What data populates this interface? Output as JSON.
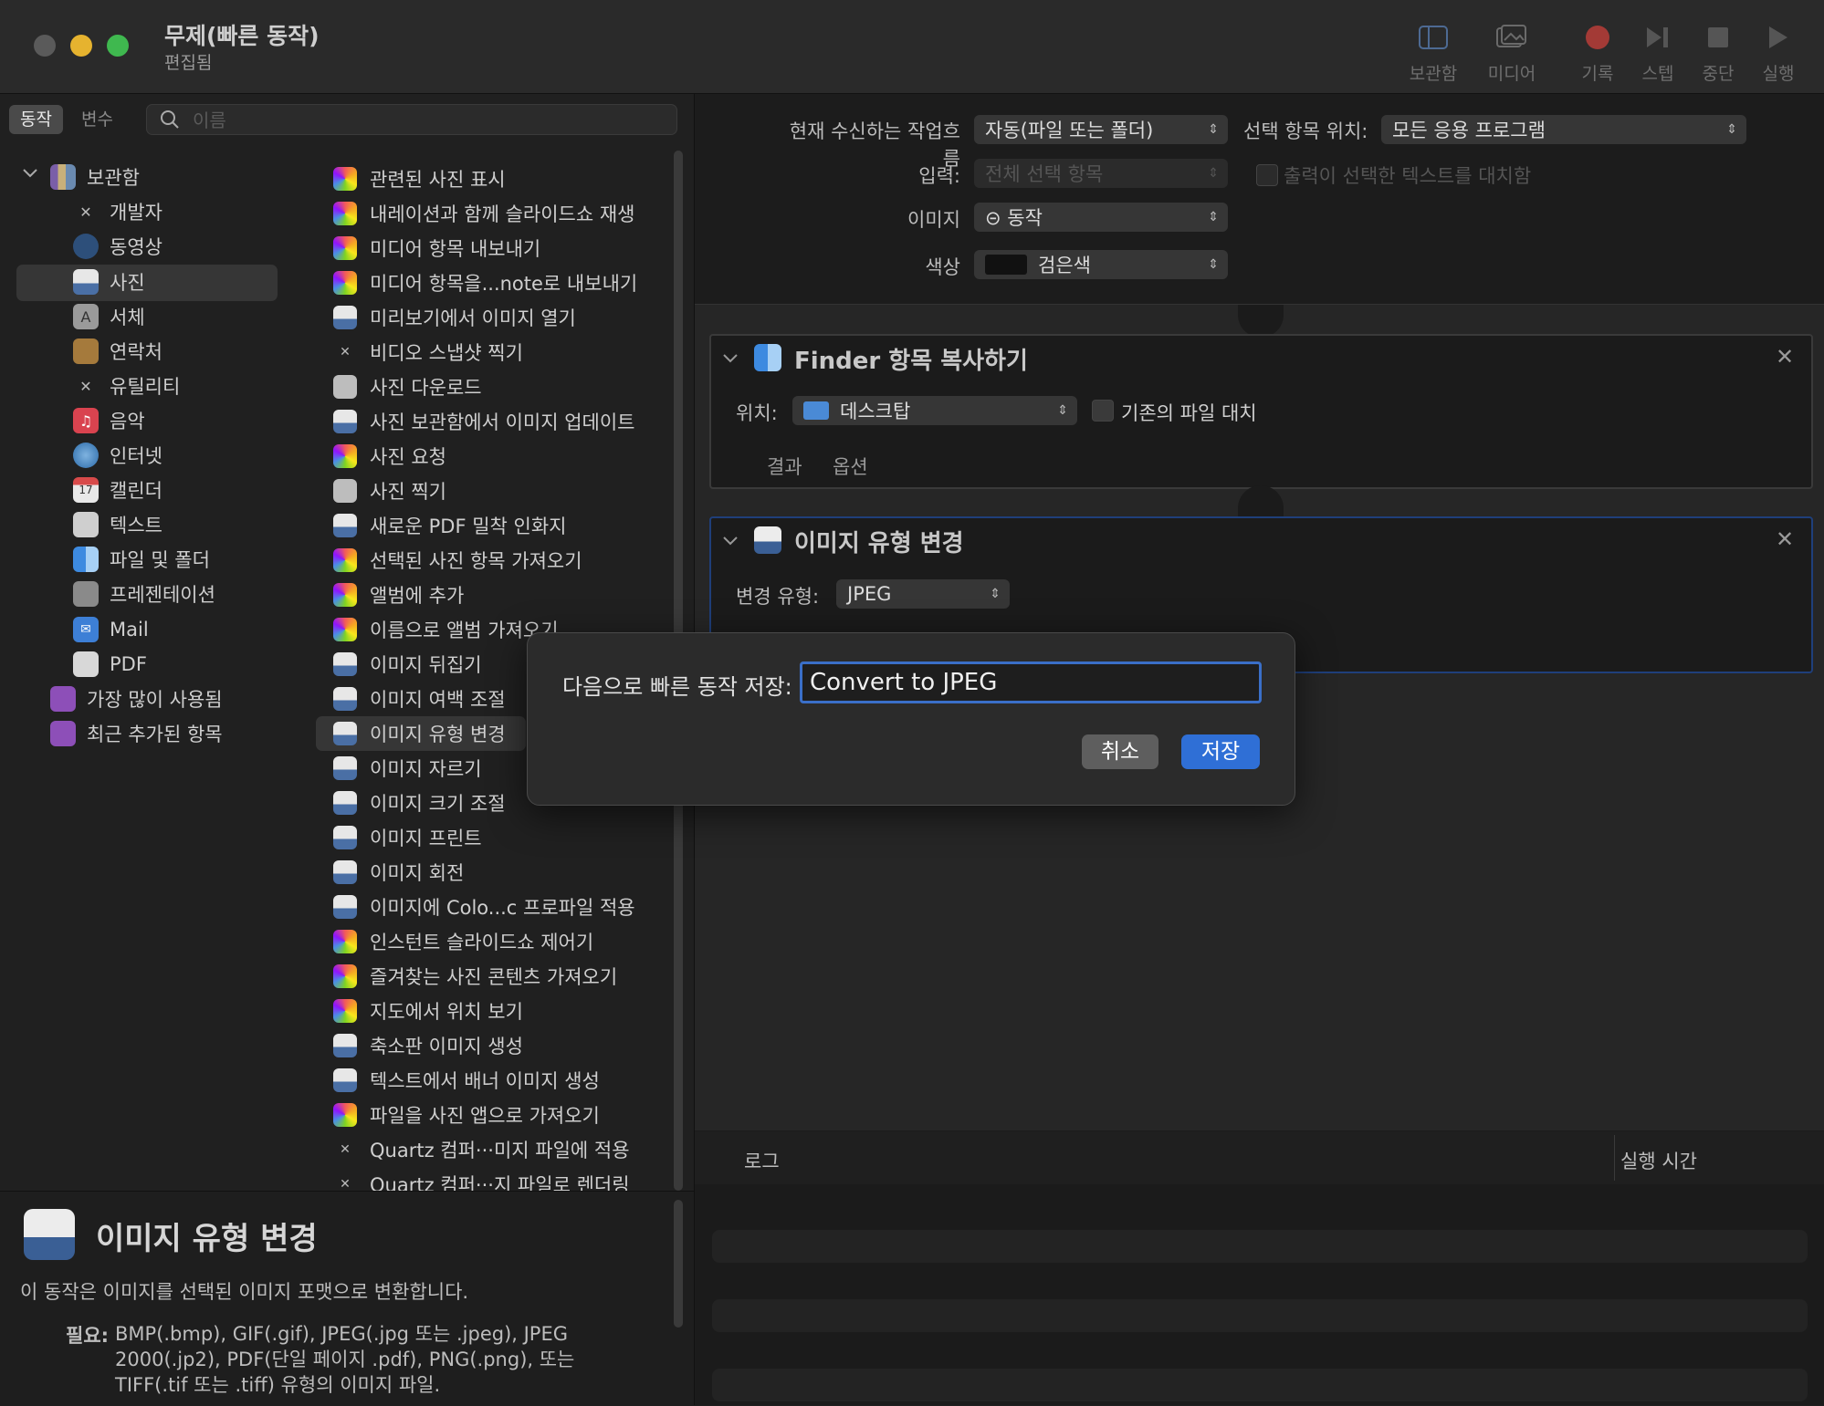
{
  "window": {
    "title": "무제(빠른 동작)",
    "subtitle": "편집됨"
  },
  "toolbar": {
    "buttons": [
      {
        "label": "보관함",
        "icon": "sidebar-icon"
      },
      {
        "label": "미디어",
        "icon": "media-icon"
      },
      {
        "label": "기록",
        "icon": "record-icon"
      },
      {
        "label": "스텝",
        "icon": "step-icon"
      },
      {
        "label": "중단",
        "icon": "stop-icon"
      },
      {
        "label": "실행",
        "icon": "play-icon"
      }
    ]
  },
  "left": {
    "segment": {
      "actions": "동작",
      "variables": "변수"
    },
    "search_placeholder": "이름",
    "library": [
      {
        "label": "보관함",
        "icon": "library-icon"
      },
      {
        "label": "개발자",
        "icon": "tools-icon"
      },
      {
        "label": "동영상",
        "icon": "movie-icon"
      },
      {
        "label": "사진",
        "icon": "photo-icon"
      },
      {
        "label": "서체",
        "icon": "font-icon"
      },
      {
        "label": "연락처",
        "icon": "contacts-icon"
      },
      {
        "label": "유틸리티",
        "icon": "utility-icon"
      },
      {
        "label": "음악",
        "icon": "music-icon"
      },
      {
        "label": "인터넷",
        "icon": "globe-icon"
      },
      {
        "label": "캘린더",
        "icon": "calendar-icon"
      },
      {
        "label": "텍스트",
        "icon": "text-icon"
      },
      {
        "label": "파일 및 폴더",
        "icon": "finder-icon"
      },
      {
        "label": "프레젠테이션",
        "icon": "presentation-icon"
      },
      {
        "label": "Mail",
        "icon": "mail-icon"
      },
      {
        "label": "PDF",
        "icon": "pdf-icon"
      },
      {
        "label": "가장 많이 사용됨",
        "icon": "smart-folder-icon"
      },
      {
        "label": "최근 추가된 항목",
        "icon": "smart-folder-icon"
      }
    ],
    "actions": [
      "관련된 사진 표시",
      "내레이션과 함께 슬라이드쇼 재생",
      "미디어 항목 내보내기",
      "미디어 항목을...note로 내보내기",
      "미리보기에서 이미지 열기",
      "비디오 스냅샷 찍기",
      "사진 다운로드",
      "사진 보관함에서 이미지 업데이트",
      "사진 요청",
      "사진 찍기",
      "새로운 PDF 밀착 인화지",
      "선택된 사진 항목 가져오기",
      "앨범에 추가",
      "이름으로 앨범 가져오기",
      "이미지 뒤집기",
      "이미지 여백 조절",
      "이미지 유형 변경",
      "이미지 자르기",
      "이미지 크기 조절",
      "이미지 프린트",
      "이미지 회전",
      "이미지에 Colo...c 프로파일 적용",
      "인스턴트 슬라이드쇼 제어기",
      "즐겨찾는 사진 콘텐츠 가져오기",
      "지도에서 위치 보기",
      "축소판 이미지 생성",
      "텍스트에서 배너 이미지 생성",
      "파일을 사진 앱으로 가져오기",
      "Quartz 컴퍼···미지 파일에 적용",
      "Quartz 컴퍼···지 파일로 렌더링"
    ],
    "description": {
      "title": "이미지 유형 변경",
      "body": "이 동작은 이미지를 선택된 이미지 포맷으로 변환합니다.",
      "requires_label": "필요:",
      "requires": "BMP(.bmp), GIF(.gif), JPEG(.jpg 또는 .jpeg), JPEG 2000(.jp2), PDF(단일 페이지 .pdf), PNG(.png), 또는 TIFF(.tif 또는 .tiff) 유형의 이미지 파일."
    }
  },
  "workflow_header": {
    "receives_label": "현재 수신하는 작업흐름",
    "receives_value": "자동(파일 또는 폴더)",
    "in_label": "선택 항목 위치:",
    "in_value": "모든 응용 프로그램",
    "input_label": "입력:",
    "input_value": "전체 선택 항목",
    "replace_label": "출력이 선택한 텍스트를 대치함",
    "image_label": "이미지",
    "image_value": "⊝ 동작",
    "color_label": "색상",
    "color_value": "검은색",
    "color_swatch": "#111111"
  },
  "actions_in_workflow": [
    {
      "title": "Finder 항목 복사하기",
      "to_label": "위치:",
      "to_value": "데스크탑",
      "replace_label": "기존의 파일 대치",
      "tabs": [
        "결과",
        "옵션"
      ]
    },
    {
      "title": "이미지 유형 변경",
      "type_label": "변경 유형:",
      "type_value": "JPEG"
    }
  ],
  "log": {
    "col_log": "로그",
    "col_duration": "실행 시간"
  },
  "dialog": {
    "label": "다음으로 빠른 동작 저장:",
    "value": "Convert to JPEG",
    "cancel": "취소",
    "save": "저장"
  },
  "colors": {
    "accent": "#2f6fd6",
    "close": "#5a5a5a",
    "minimize": "#e6b32f",
    "zoom": "#3fb84f"
  }
}
